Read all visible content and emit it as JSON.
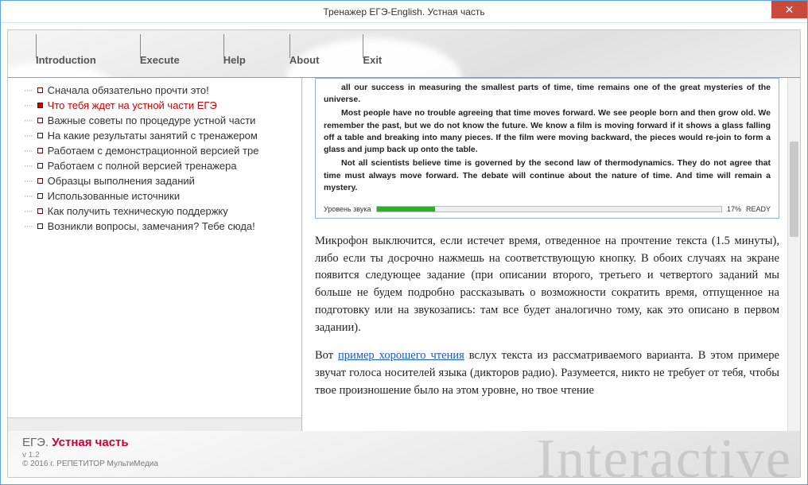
{
  "window": {
    "title": "Тренажер ЕГЭ-English. Устная часть"
  },
  "menu": [
    "Introduction",
    "Execute",
    "Help",
    "About",
    "Exit"
  ],
  "tree": {
    "items": [
      {
        "label": "Сначала обязательно прочти это!",
        "selected": false
      },
      {
        "label": "Что тебя ждет на устной части ЕГЭ",
        "selected": true
      },
      {
        "label": "Важные советы по процедуре устной части",
        "selected": false
      },
      {
        "label": "На какие результаты занятий с тренажером",
        "selected": false
      },
      {
        "label": "Работаем с демонстрационной версией тре",
        "selected": false
      },
      {
        "label": "Работаем с полной версией тренажера",
        "selected": false
      },
      {
        "label": "Образцы выполнения заданий",
        "selected": false
      },
      {
        "label": "Использованные источники",
        "selected": false
      },
      {
        "label": "Как получить техническую поддержку",
        "selected": false
      },
      {
        "label": "Возникли вопросы, замечания? Тебе сюда!",
        "selected": false
      }
    ]
  },
  "inset": {
    "p1": "all our success in measuring the smallest parts of time, time remains one of the great mysteries of the universe.",
    "p2": "Most people have no trouble agreeing that time moves forward. We see people born and then grow old. We remember the past, but we do not know the future. We know a film is moving forward if it shows a glass falling off a table and breaking into many pieces. If the film were moving backward, the pieces would re-join to form a glass and jump back up onto the table.",
    "p3": "Not all scientists believe time is governed by the second law of thermodynamics. They do not agree that time must always move forward. The debate will continue about the nature of time. And time will remain a mystery.",
    "sound_label": "Уровень звука",
    "percent": "17%",
    "ready": "READY"
  },
  "article": {
    "p1a": "Микрофон выключится, если истечет время, отведенное на прочтение текста (1.5 минуты), либо если ты досрочно нажмешь на соответствующую кнопку. В обоих случаях на экране появится следующее задание (при описании второго, третьего и четвертого заданий мы больше не будем подробно рассказывать о возможности сократить время, отпущенное на подготовку или на звукозапись: там все будет аналогично тому, как это описано в первом задании).",
    "p2_pre": "Вот ",
    "p2_link": "пример хорошего чтения",
    "p2_post": " вслух текста из рассматриваемого варианта. В этом примере звучат голоса носителей языка (дикторов радио). Разумеется, никто не требует от тебя, чтобы твое произношение было на этом уровне, но твое чтение"
  },
  "footer": {
    "brand_a": "ЕГЭ. ",
    "brand_b": "Устная часть",
    "version": "v  1.2",
    "copyright": "© 2016 г. РЕПЕТИТОР МультиМедиа",
    "watermark": "Interactive"
  }
}
